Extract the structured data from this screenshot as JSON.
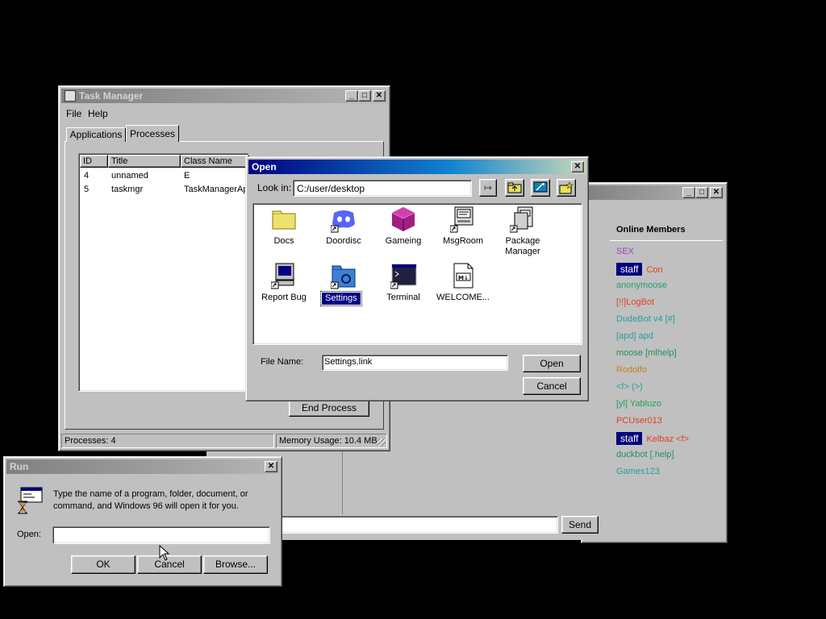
{
  "task_manager": {
    "title": "Task Manager",
    "menu": [
      "File",
      "Help"
    ],
    "tabs": [
      "Applications",
      "Processes"
    ],
    "columns": [
      "ID",
      "Title",
      "Class Name"
    ],
    "rows": [
      {
        "id": "4",
        "title": "unnamed",
        "class": "E"
      },
      {
        "id": "5",
        "title": "taskmgr",
        "class": "TaskManagerAp"
      }
    ],
    "end_process": "End Process",
    "status_processes": "Processes: 4",
    "status_memory": "Memory Usage: 10.4 MB"
  },
  "chat": {
    "members_title": "Online Members",
    "members": [
      {
        "badge": "",
        "name": "SEX",
        "color": "#a040c0"
      },
      {
        "badge": "staff",
        "name": "Con",
        "color": "#e04020"
      },
      {
        "badge": "",
        "name": "anonymoose",
        "color": "#20a070"
      },
      {
        "badge": "",
        "name": "[!!]LogBot",
        "color": "#e04020"
      },
      {
        "badge": "",
        "name": "DudeBot v4 [#]",
        "color": "#20a0a0"
      },
      {
        "badge": "",
        "name": "[apd] apd",
        "color": "#20a0a0"
      },
      {
        "badge": "",
        "name": "moose [mlhelp]",
        "color": "#209060"
      },
      {
        "badge": "",
        "name": "Rodolfo",
        "color": "#c08020"
      },
      {
        "badge": "",
        "name": "<f> (>)",
        "color": "#20a0a0"
      },
      {
        "badge": "",
        "name": "[yl] Yabluzo",
        "color": "#20a060"
      },
      {
        "badge": "",
        "name": "PCUser013",
        "color": "#e04020"
      },
      {
        "badge": "staff",
        "name": "Kelbaz <f>",
        "color": "#e04020"
      },
      {
        "badge": "",
        "name": "duckbot [.help]",
        "color": "#209060"
      },
      {
        "badge": "",
        "name": "Games123",
        "color": "#20a0a0"
      }
    ],
    "send": "Send"
  },
  "open_dialog": {
    "title": "Open",
    "look_in_label": "Look in:",
    "look_in_value": "C:/user/desktop",
    "files": [
      {
        "name": "Docs",
        "icon": "folder-icon"
      },
      {
        "name": "Doordisc",
        "icon": "discord-icon"
      },
      {
        "name": "Gameing",
        "icon": "cube-icon"
      },
      {
        "name": "MsgRoom",
        "icon": "msgroom-icon"
      },
      {
        "name": "Package Manager",
        "icon": "package-manager-icon"
      },
      {
        "name": "Report Bug",
        "icon": "computer-icon"
      },
      {
        "name": "Settings",
        "icon": "settings-folder-icon"
      },
      {
        "name": "Terminal",
        "icon": "terminal-icon"
      },
      {
        "name": "WELCOME...",
        "icon": "markdown-file-icon"
      }
    ],
    "selected": "Settings",
    "file_name_label": "File Name:",
    "file_name_value": "Settings.link",
    "open": "Open",
    "cancel": "Cancel"
  },
  "run_dialog": {
    "title": "Run",
    "description": "Type the name of a program, folder, document, or command, and Windows 96 will open it for you.",
    "open_label": "Open:",
    "open_value": "",
    "ok": "OK",
    "cancel": "Cancel",
    "browse": "Browse..."
  }
}
